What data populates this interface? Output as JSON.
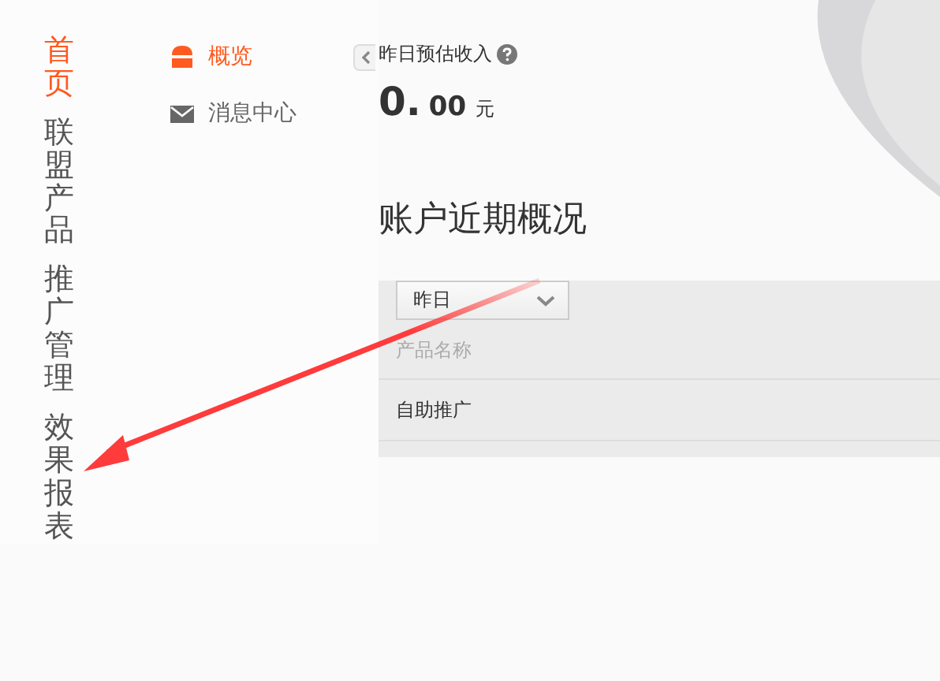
{
  "main_nav": [
    {
      "label": "首页",
      "selected": true
    },
    {
      "label": "联盟产品",
      "selected": false
    },
    {
      "label": "推广管理",
      "selected": false
    },
    {
      "label": "效果报表",
      "selected": false
    }
  ],
  "sub_nav": {
    "items": [
      {
        "kind": "overview",
        "label": "概览",
        "selected": true
      },
      {
        "kind": "message",
        "label": "消息中心",
        "selected": false
      }
    ]
  },
  "income": {
    "label": "昨日预估收入",
    "integer": "0.",
    "decimal": "00",
    "unit": "元"
  },
  "section_title": "账户近期概况",
  "filter": {
    "value": "昨日"
  },
  "table": {
    "columns": [
      "产品名称"
    ],
    "rows": [
      [
        "自助推广"
      ]
    ]
  }
}
